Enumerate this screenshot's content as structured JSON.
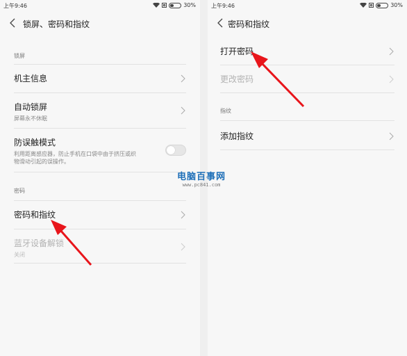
{
  "left": {
    "status": {
      "time": "上午9:46",
      "battery": "30%",
      "battery_level": 0.3
    },
    "title": "锁屏、密码和指纹",
    "sections": {
      "lock_screen": {
        "label": "锁屏"
      },
      "password": {
        "label": "密码"
      }
    },
    "items": {
      "owner_info": {
        "label": "机主信息"
      },
      "auto_lock": {
        "label": "自动锁屏",
        "sub": "屏幕永不休眠"
      },
      "anti_touch": {
        "label": "防误触模式",
        "sub_line1": "利用距离感应器，防止手机在口袋中由于挤压或织",
        "sub_line2": "物滑动引起的误操作。",
        "toggle_on": false
      },
      "password_fp": {
        "label": "密码和指纹"
      },
      "bluetooth_unlock": {
        "label": "蓝牙设备解锁",
        "sub": "关闭"
      }
    }
  },
  "right": {
    "status": {
      "time": "上午9:46",
      "battery": "30%",
      "battery_level": 0.3
    },
    "title": "密码和指纹",
    "items": {
      "turn_on_password": {
        "label": "打开密码"
      },
      "change_password": {
        "label": "更改密码"
      },
      "add_fingerprint": {
        "label": "添加指纹"
      }
    },
    "sections": {
      "fingerprint": {
        "label": "指纹"
      }
    }
  },
  "watermark": {
    "title": "电脑百事网",
    "url": "www.pc841.com"
  },
  "colors": {
    "arrow": "#e8151b",
    "watermark": "#1e6fb8"
  }
}
